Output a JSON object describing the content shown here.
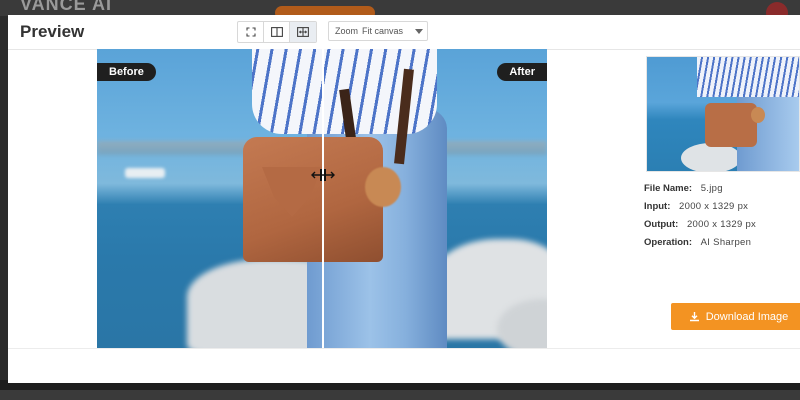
{
  "background": {
    "logo": "VANCE AI"
  },
  "modal": {
    "title": "Preview",
    "view_modes": [
      {
        "name": "fullscreen-view",
        "icon": "expand-icon"
      },
      {
        "name": "side-by-side-view",
        "icon": "split-view-icon"
      },
      {
        "name": "slider-compare-view",
        "icon": "compare-slider-icon",
        "active": true
      }
    ],
    "zoom": {
      "label": "Zoom",
      "value": "Fit canvas"
    },
    "preview": {
      "before_label": "Before",
      "after_label": "After"
    },
    "details": {
      "file_name": {
        "label": "File Name:",
        "value": "5.jpg"
      },
      "input": {
        "label": "Input:",
        "value": "2000 x 1329 px"
      },
      "output": {
        "label": "Output:",
        "value": "2000 x 1329 px"
      },
      "operation": {
        "label": "Operation:",
        "value": "AI Sharpen"
      }
    },
    "download_label": "Download Image"
  },
  "colors": {
    "accent": "#f39322",
    "tag_bg": "#1f1f1f"
  }
}
